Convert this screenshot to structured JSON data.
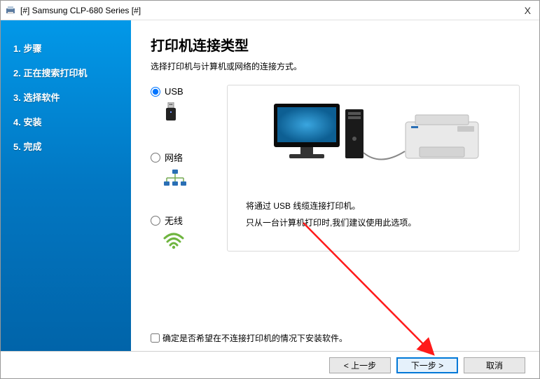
{
  "window_title": "[#] Samsung CLP-680 Series [#]",
  "close_glyph": "X",
  "sidebar": {
    "items": [
      {
        "label": "1. 步骤"
      },
      {
        "label": "2. 正在搜索打印机"
      },
      {
        "label": "3. 选择软件"
      },
      {
        "label": "4. 安装"
      },
      {
        "label": "5. 完成"
      }
    ]
  },
  "heading": "打印机连接类型",
  "subtitle": "选择打印机与计算机或网络的连接方式。",
  "options": {
    "usb": "USB",
    "network": "网络",
    "wireless": "无线"
  },
  "description": {
    "line1": "将通过 USB 线缆连接打印机。",
    "line2": "只从一台计算机打印时,我们建议使用此选项。"
  },
  "checkbox_label": "确定是否希望在不连接打印机的情况下安装软件。",
  "buttons": {
    "back": "< 上一步",
    "next": "下一步 >",
    "cancel": "取消"
  }
}
